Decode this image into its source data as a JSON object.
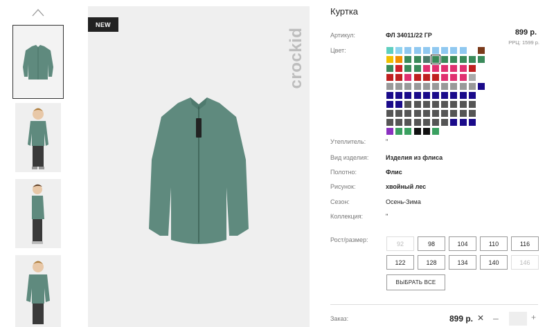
{
  "thumbnails": {
    "up_arrow": "chevron-up-icon",
    "items": [
      "jacket-front",
      "model-front",
      "model-side",
      "model-smile"
    ]
  },
  "main_image": {
    "badge": "NEW",
    "brand": "crockid"
  },
  "product": {
    "title": "Куртка",
    "article_label": "Артикул:",
    "article_value": "ФЛ 34011/22 ГР",
    "price": "899 р.",
    "rrp": "РРЦ: 1599 р.",
    "color_label": "Цвет:",
    "swatches": [
      "#5fcfbf",
      "#8fd3f0",
      "#8fc8f0",
      "#8fc8f0",
      "#8fc8f0",
      "#8fc8f0",
      "#8fc8f0",
      "#8fc8f0",
      "#8fc8f0",
      "#fff",
      "#7a3a1a",
      "#f0c000",
      "#f09000",
      "#3a8a5a",
      "#3a8a5a",
      "#4a7a6a",
      "#3a8a5a",
      "#3a8a5a",
      "#3a8a5a",
      "#3a8a5a",
      "#3a8a5a",
      "#3a8a5a",
      "#3a8a5a",
      "#d0202a",
      "#3a8a5a",
      "#3a8a5a",
      "#e03070",
      "#e03070",
      "#e03070",
      "#e03070",
      "#e03070",
      "#c02020",
      "#fff",
      "#c02020",
      "#c02020",
      "#e03070",
      "#c02020",
      "#c02020",
      "#c02020",
      "#e03070",
      "#e03070",
      "#e03070",
      "#aaaaaa",
      "#fff",
      "#999999",
      "#999999",
      "#999999",
      "#999999",
      "#999999",
      "#999999",
      "#999999",
      "#999999",
      "#999999",
      "#999999",
      "#1a0a8a",
      "#1a0a8a",
      "#1a0a8a",
      "#1a0a8a",
      "#1a0a8a",
      "#1a0a8a",
      "#1a0a8a",
      "#1a0a8a",
      "#1a0a8a",
      "#1a0a8a",
      "#1a0a8a",
      "#fff",
      "#1a0a8a",
      "#1a0a8a",
      "#555555",
      "#555555",
      "#555555",
      "#555555",
      "#555555",
      "#555555",
      "#555555",
      "#555555",
      "#fff",
      "#555555",
      "#555555",
      "#555555",
      "#555555",
      "#555555",
      "#555555",
      "#555555",
      "#555555",
      "#555555",
      "#555555",
      "#fff",
      "#555555",
      "#555555",
      "#555555",
      "#555555",
      "#555555",
      "#555555",
      "#555555",
      "#1a0a8a",
      "#1a0a8a",
      "#1a0a8a",
      "#fff",
      "#8a30c0",
      "#3aa060",
      "#3aa060",
      "#111111",
      "#111111",
      "#3aa060"
    ],
    "selected_swatch_index": 16,
    "fields": [
      {
        "label": "Утеплитель:",
        "value": "\"",
        "bold": false
      },
      {
        "label": "Вид изделия:",
        "value": "Изделия из флиса",
        "bold": true
      },
      {
        "label": "Полотно:",
        "value": "Флис",
        "bold": true
      },
      {
        "label": "Рисунок:",
        "value": "хвойный лес",
        "bold": true
      },
      {
        "label": "Сезон:",
        "value": "Осень-Зима",
        "bold": false
      },
      {
        "label": "Коллекция:",
        "value": "\"",
        "bold": false
      }
    ],
    "size_label": "Рост/размер:",
    "sizes": [
      {
        "label": "92",
        "disabled": true
      },
      {
        "label": "98",
        "disabled": false
      },
      {
        "label": "104",
        "disabled": false
      },
      {
        "label": "110",
        "disabled": false
      },
      {
        "label": "116",
        "disabled": false
      },
      {
        "label": "122",
        "disabled": false
      },
      {
        "label": "128",
        "disabled": false
      },
      {
        "label": "134",
        "disabled": false
      },
      {
        "label": "140",
        "disabled": false
      },
      {
        "label": "146",
        "disabled": true
      }
    ],
    "select_all": "ВЫБРАТЬ ВСЕ"
  },
  "order": {
    "label": "Заказ:",
    "price": "899 р.",
    "remove": "✕",
    "minus": "–",
    "quantity": "",
    "plus": "+"
  }
}
